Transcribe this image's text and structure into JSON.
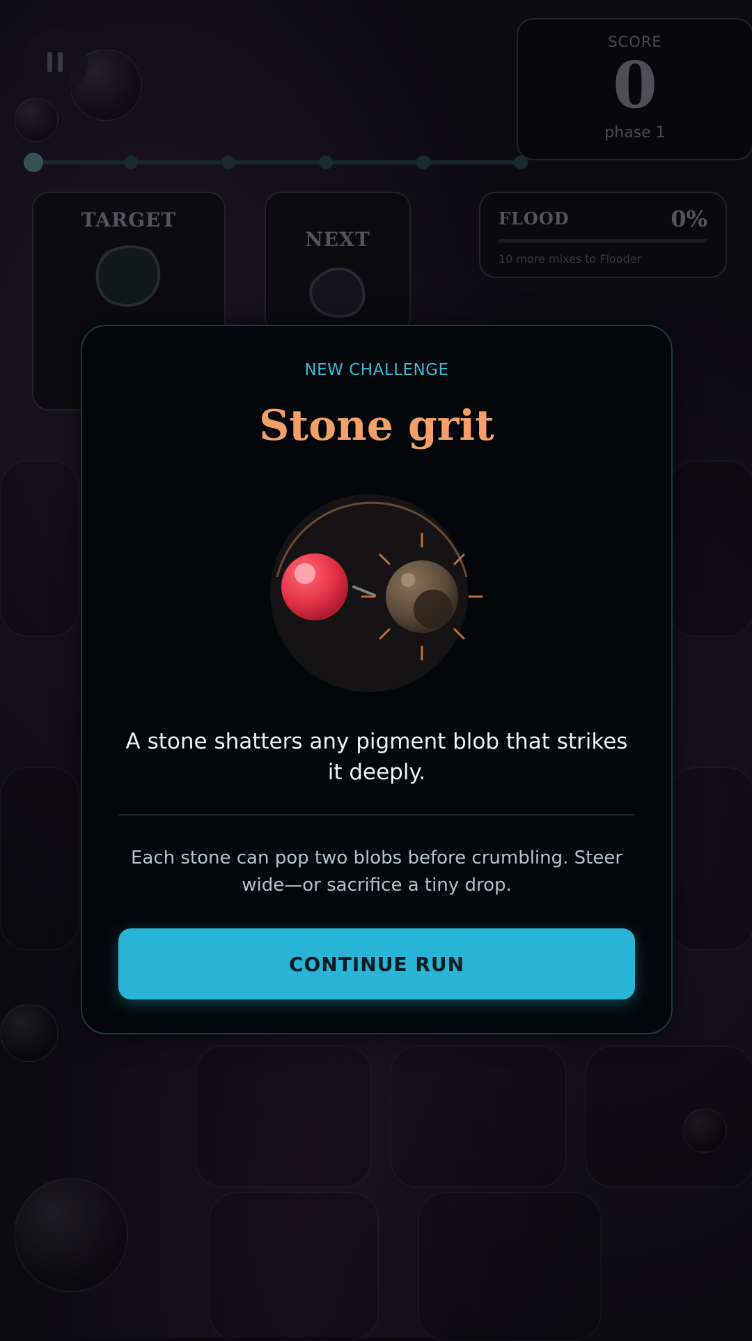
{
  "hud": {
    "score_label": "SCORE",
    "score_value": "0",
    "phase": "phase 1",
    "target_label": "TARGET",
    "next_label": "NEXT",
    "flood_label": "FLOOD",
    "flood_percent": "0%",
    "flood_note": "10 more mixes to Flooder",
    "flood_progress": 0
  },
  "modal": {
    "eyebrow": "NEW CHALLENGE",
    "title": "Stone grit",
    "description": "A stone shatters any pigment blob that strikes it deeply.",
    "tip": "Each stone can pop two blobs before crumbling. Steer wide—or sacrifice a tiny drop.",
    "button_label": "CONTINUE RUN"
  },
  "colors": {
    "accent": "#29b4d8",
    "title": "#f4a068",
    "red_blob": "#e8344a",
    "stone": "#5a4838"
  },
  "icons": [
    "pause-icon",
    "target-blob-icon",
    "next-blob-icon",
    "red-blob-icon",
    "stone-icon"
  ]
}
